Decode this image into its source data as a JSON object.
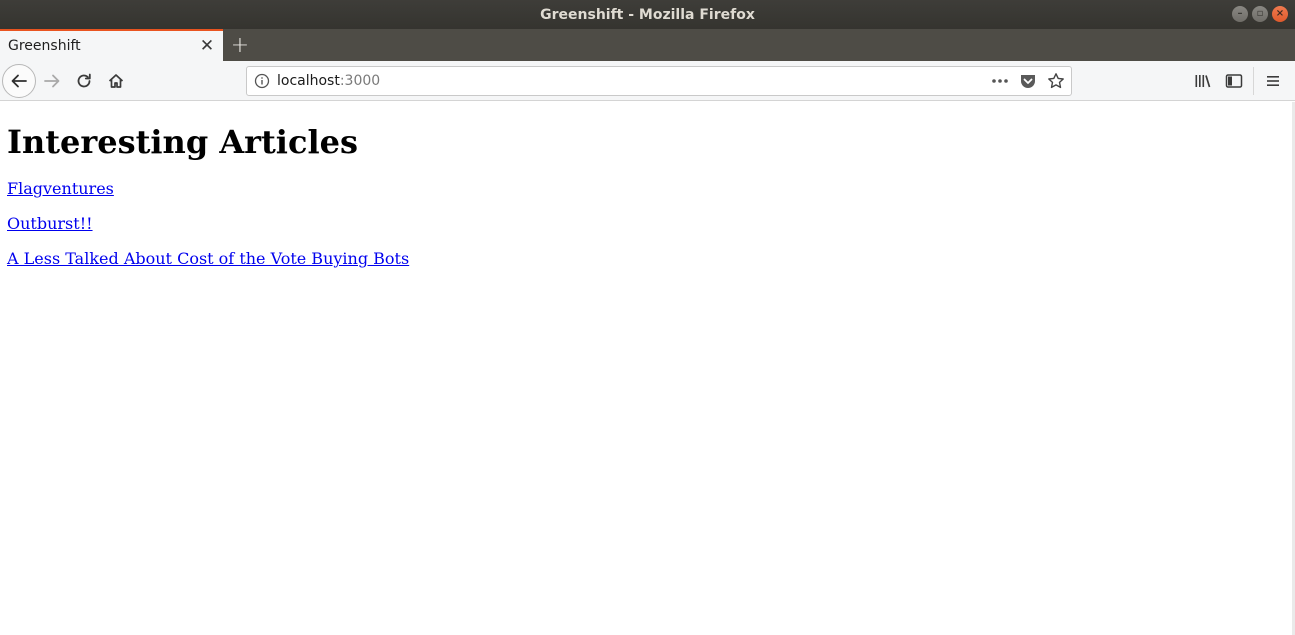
{
  "window": {
    "title": "Greenshift - Mozilla Firefox",
    "controls": [
      "minimize-icon",
      "maximize-icon",
      "close-icon"
    ]
  },
  "tabs": [
    {
      "title": "Greenshift",
      "active": true
    }
  ],
  "toolbar": {
    "url_host": "localhost",
    "url_port": ":3000",
    "icons": [
      "back-icon",
      "forward-icon",
      "reload-icon",
      "home-icon",
      "info-icon",
      "page-actions-icon",
      "pocket-icon",
      "bookmark-star-icon",
      "library-icon",
      "sidebar-icon",
      "hamburger-menu-icon"
    ]
  },
  "page": {
    "heading": "Interesting Articles",
    "links": [
      {
        "label": "Flagventures"
      },
      {
        "label": "Outburst!!"
      },
      {
        "label": "A Less Talked About Cost of the Vote Buying Bots"
      }
    ]
  },
  "colors": {
    "titlebar": "#3e3d39",
    "tab_accent": "#e95420",
    "link": "#0000ee",
    "toolbar_bg": "#f5f6f7"
  }
}
